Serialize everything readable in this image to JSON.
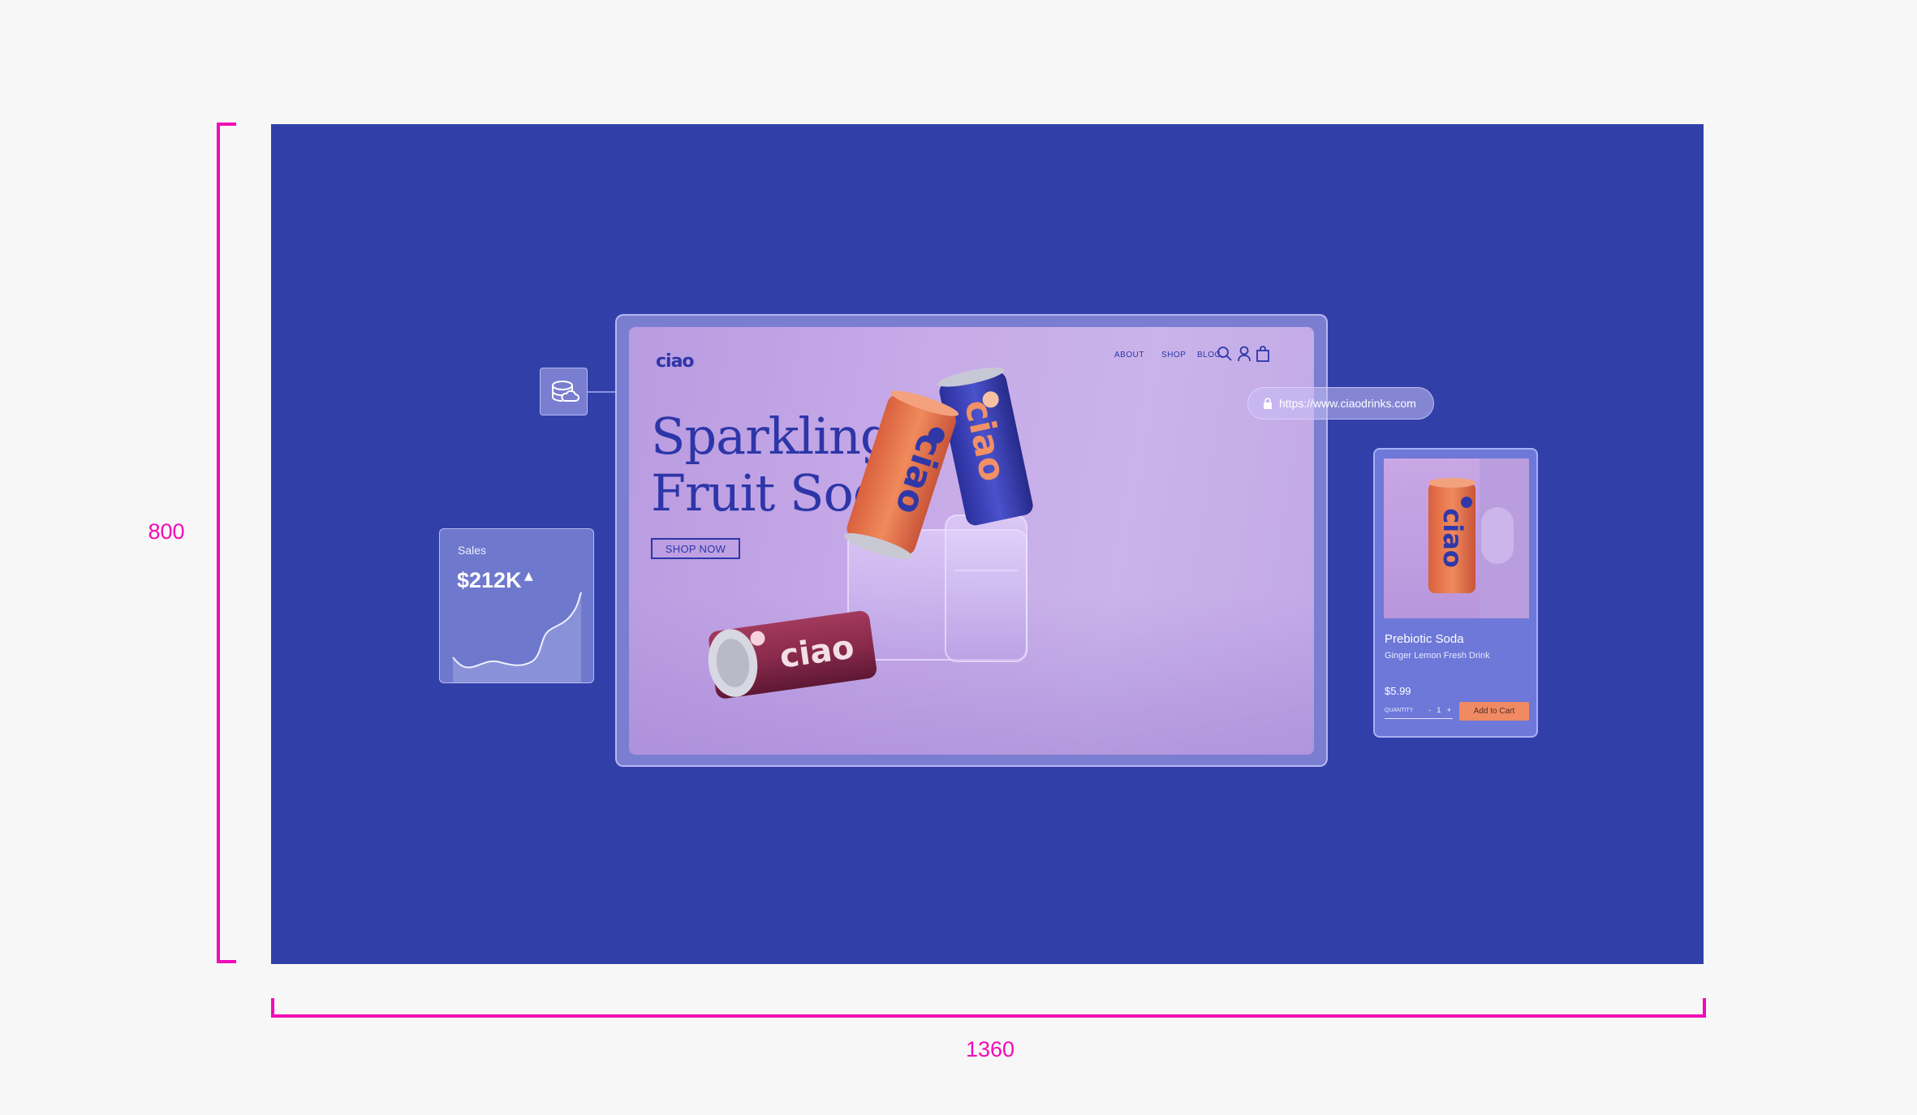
{
  "dimensions": {
    "height_label": "800",
    "width_label": "1360"
  },
  "site": {
    "logo": "ciao",
    "nav": [
      "ABOUT",
      "SHOP",
      "BLOG"
    ],
    "hero_title_line1": "Sparkling",
    "hero_title_line2": "Fruit Soda",
    "cta": "SHOP NOW",
    "can_text": "ciao"
  },
  "url_bar": {
    "url": "https://www.ciaodrinks.com"
  },
  "sales_widget": {
    "label": "Sales",
    "value": "$212K"
  },
  "product_card": {
    "name": "Prebiotic Soda",
    "description": "Ginger Lemon Fresh Drink",
    "price": "$5.99",
    "quantity_label": "QUANTITY",
    "quantity_minus": "-",
    "quantity": "1",
    "quantity_plus": "+",
    "cta": "Add to Cart"
  },
  "colors": {
    "canvas": "#3140a9",
    "annotation": "#f20bb6",
    "brand": "#2d36a8",
    "orange_can": "#ec7a4f",
    "blue_can": "#3a3fb8",
    "red_can": "#8a2a4c"
  }
}
